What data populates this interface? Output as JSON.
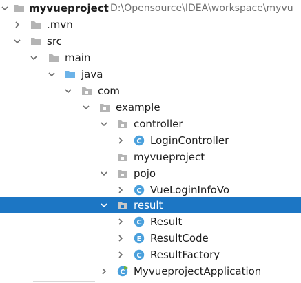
{
  "project": {
    "name": "myvueproject",
    "path": "D:\\Opensource\\IDEA\\workspace\\myvu"
  },
  "tree": {
    "items": [
      {
        "label": "myvueproject",
        "icon": "folder-icon",
        "expanded": true,
        "selected": false,
        "bold": true
      },
      {
        "label": ".mvn",
        "icon": "folder-icon",
        "expanded": false,
        "selected": false
      },
      {
        "label": "src",
        "icon": "folder-icon",
        "expanded": true,
        "selected": false
      },
      {
        "label": "main",
        "icon": "folder-icon",
        "expanded": true,
        "selected": false
      },
      {
        "label": "java",
        "icon": "source-root-folder-icon",
        "expanded": true,
        "selected": false
      },
      {
        "label": "com",
        "icon": "package-icon",
        "expanded": true,
        "selected": false
      },
      {
        "label": "example",
        "icon": "package-icon",
        "expanded": true,
        "selected": false
      },
      {
        "label": "controller",
        "icon": "package-icon",
        "expanded": true,
        "selected": false
      },
      {
        "label": "LoginController",
        "icon": "class-icon",
        "expanded": false,
        "selected": false
      },
      {
        "label": "myvueproject",
        "icon": "package-icon",
        "expanded": null,
        "selected": false
      },
      {
        "label": "pojo",
        "icon": "package-icon",
        "expanded": true,
        "selected": false
      },
      {
        "label": "VueLoginInfoVo",
        "icon": "class-icon",
        "expanded": false,
        "selected": false
      },
      {
        "label": "result",
        "icon": "package-icon",
        "expanded": true,
        "selected": true
      },
      {
        "label": "Result",
        "icon": "class-icon",
        "expanded": false,
        "selected": false
      },
      {
        "label": "ResultCode",
        "icon": "enum-icon",
        "expanded": false,
        "selected": false
      },
      {
        "label": "ResultFactory",
        "icon": "class-icon",
        "expanded": false,
        "selected": false
      },
      {
        "label": "MyvueprojectApplication",
        "icon": "spring-boot-class-icon",
        "expanded": false,
        "selected": false
      }
    ]
  },
  "icon_glyphs": {
    "class": "C",
    "enum": "E"
  },
  "colors": {
    "selection": "#1c76c4",
    "folder": "#b4b4b4",
    "source_root": "#6cb3e8",
    "class_icon": "#4aa0dc",
    "enum_icon": "#4aa0dc",
    "spring": "#6db33f"
  }
}
